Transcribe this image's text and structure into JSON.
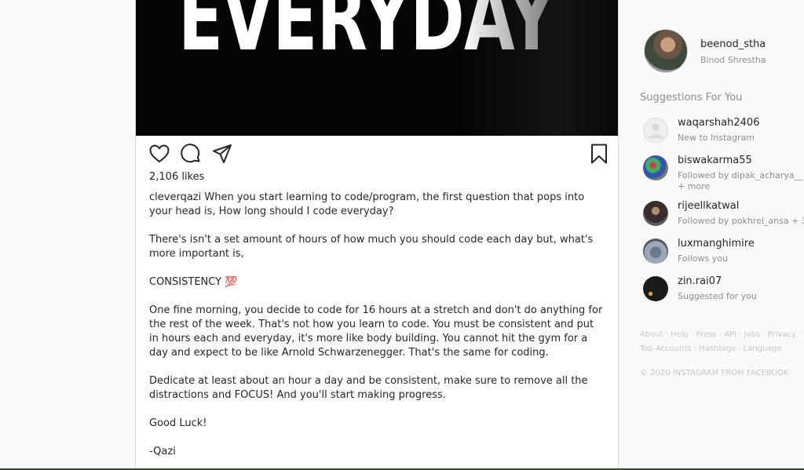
{
  "post": {
    "image_text": "EVERYDAY",
    "likes": "2,106 likes",
    "caption": {
      "username": "cleverqazi",
      "first": " When you start learning to code/program, the first question that pops into your head is, How long should I code everyday?",
      "p2": "There's isn't a set amount of hours of how much you should code each day but, what's more important is,",
      "p3": "CONSISTENCY 💯",
      "p4": "One fine morning, you decide to code for 16 hours at a stretch and don't do anything for the rest of the week. That's not how you learn to code. You must be consistent and put in hours each and everyday, it's more like body building. You cannot hit the gym for a day and expect to be like Arnold Schwarzenegger. That's the same for coding.",
      "p5": "Dedicate at least about an hour a day and be consistent, make sure to remove all the distractions and FOCUS! And you'll start making progress.",
      "p6": "Good Luck!",
      "p7": "-Qazi"
    },
    "icons": [
      "heart-icon",
      "comment-icon",
      "share-icon",
      "bookmark-icon"
    ]
  },
  "profile": {
    "username": "beenod_stha",
    "fullname": "Binod Shrestha"
  },
  "suggestions": {
    "title": "Suggestions For You",
    "items": [
      {
        "name": "waqarshah2406",
        "sub": "New to Instagram"
      },
      {
        "name": "biswakarma55",
        "sub": "Followed by dipak_acharya__ + more"
      },
      {
        "name": "rijeellkatwal",
        "sub": "Followed by pokhrel_ansa + 3"
      },
      {
        "name": "luxmanghimire",
        "sub": "Follows you"
      },
      {
        "name": "zin.rai07",
        "sub": "Suggested for you"
      }
    ]
  },
  "footer": {
    "links_row1": "About · Help · Press · API · Jobs · Privacy · Te",
    "links_row2": "Top Accounts · Hashtags · Language",
    "copyright": "© 2020 INSTAGRAM FROM FACEBOOK"
  },
  "colors": {
    "text": "#262626",
    "secondary": "#8e8e8e",
    "border": "#dbdbdb",
    "footer": "#c7c7c7"
  }
}
